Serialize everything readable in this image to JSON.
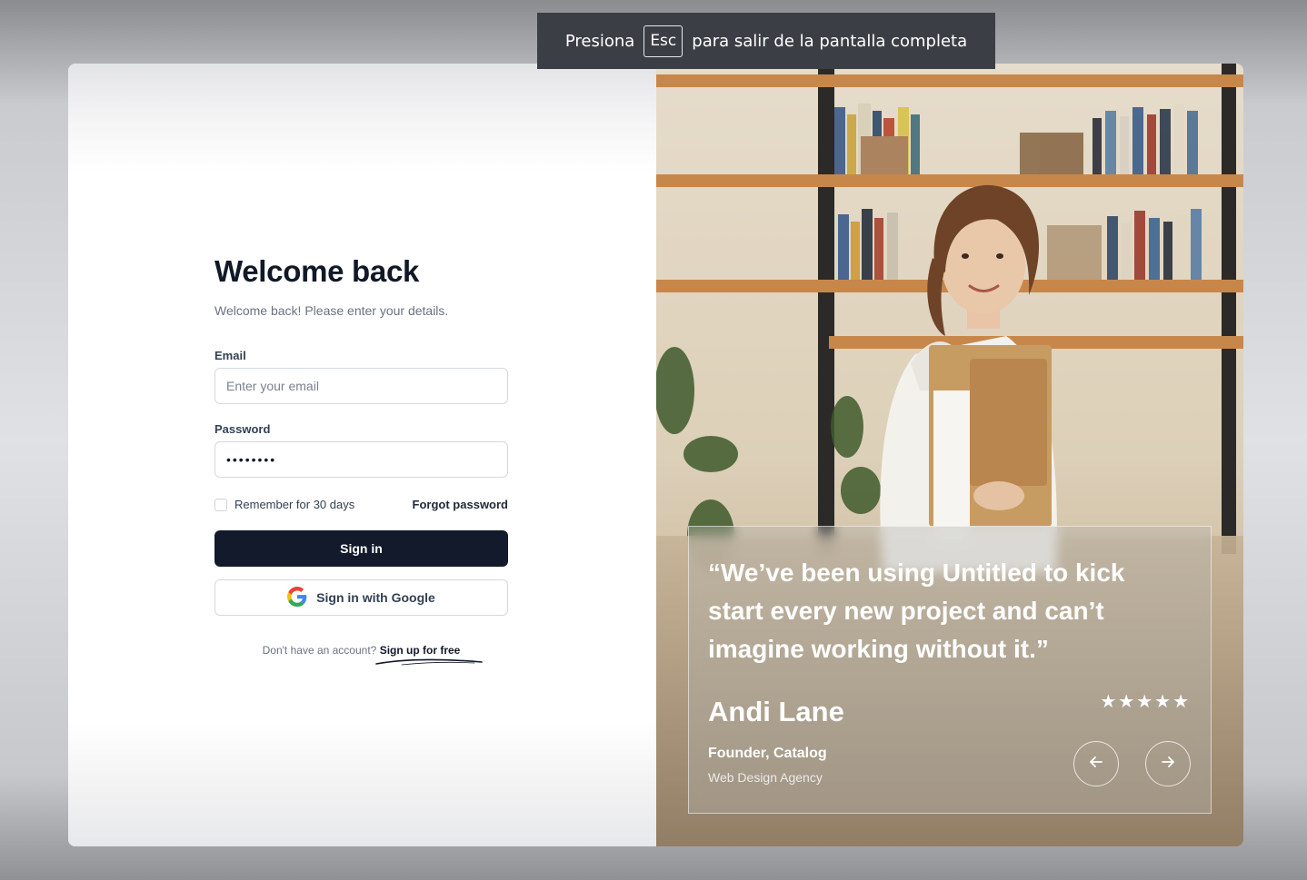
{
  "toast": {
    "before": "Presiona",
    "key": "Esc",
    "after": "para salir de la pantalla completa"
  },
  "login": {
    "title": "Welcome back",
    "subtitle": "Welcome back! Please enter your details.",
    "email_label": "Email",
    "email_placeholder": "Enter your email",
    "email_value": "",
    "password_label": "Password",
    "password_value": "••••••••",
    "remember_label": "Remember for 30 days",
    "remember_checked": false,
    "forgot_label": "Forgot password",
    "signin_label": "Sign in",
    "google_label": "Sign in with Google",
    "no_account_text": "Don't have an account?",
    "signup_label": "Sign up for free"
  },
  "testimonial": {
    "quote": "“We’ve been using Untitled to kick start every new project and can’t imagine working without it.”",
    "name": "Andi Lane",
    "rating": 5,
    "stars": "★★★★★",
    "role": "Founder, Catalog",
    "company": "Web Design Agency",
    "prev_icon": "arrow-left-icon",
    "next_icon": "arrow-right-icon"
  },
  "colors": {
    "primary_button": "#121a2b",
    "title_text": "#111827",
    "toast_bg": "#3b3f45"
  }
}
